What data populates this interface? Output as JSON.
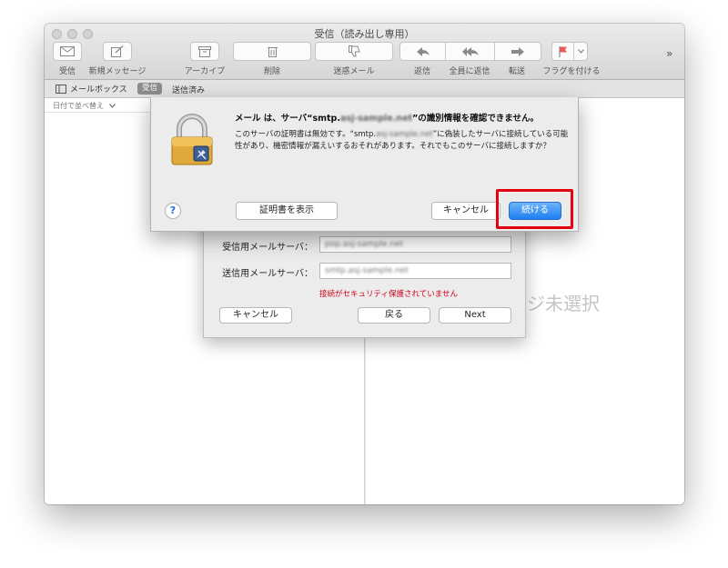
{
  "window": {
    "title": "受信（読み出し専用）"
  },
  "toolbar": {
    "receive_label": "受信",
    "new_message_label": "新規メッセージ",
    "archive_label": "アーカイブ",
    "delete_label": "削除",
    "junk_label": "迷惑メール",
    "reply_label": "返信",
    "reply_all_label": "全員に返信",
    "forward_label": "転送",
    "flag_label": "フラグを付ける",
    "overflow": "»"
  },
  "favorites": {
    "mailboxes": "メールボックス",
    "inbox": "受信",
    "sent": "送信済み"
  },
  "list": {
    "sort_label": "日付で並べ替え"
  },
  "viewer": {
    "no_message_text": "ジ未選択"
  },
  "setup": {
    "incoming_label": "受信用メールサーバ：",
    "incoming_value": "pop.asj-sample.net",
    "outgoing_label": "送信用メールサーバ：",
    "outgoing_value": "smtp.asj-sample.net",
    "warning": "接続がセキュリティ保護されていません",
    "cancel": "キャンセル",
    "back": "戻る",
    "next": "Next"
  },
  "alert": {
    "title_pre": "メール は、サーバ“smtp.",
    "title_blur": "asj-sample.net",
    "title_post": "”の識別情報を確認できません。",
    "body_1": "このサーバの証明書は無効です。“smtp.",
    "body_blur": "asj-sample.net",
    "body_2": "”に偽装したサーバに接続している可能性があり、機密情報が漏えいするおそれがあります。それでもこのサーバに接続しますか？",
    "help": "?",
    "show_cert": "証明書を表示",
    "cancel": "キャンセル",
    "continue": "続ける"
  },
  "colors": {
    "accent": "#1d7ff0",
    "highlight": "#e3000f",
    "warning": "#d0021b"
  }
}
